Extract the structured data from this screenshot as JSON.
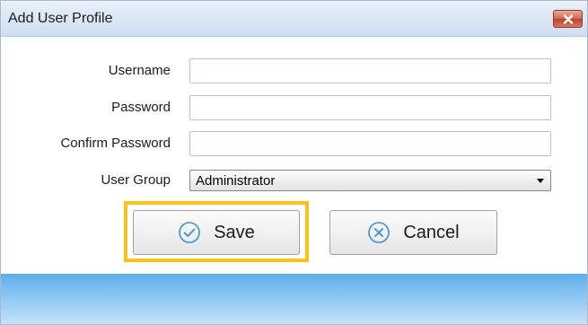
{
  "window": {
    "title": "Add User Profile"
  },
  "form": {
    "username": {
      "label": "Username",
      "value": ""
    },
    "password": {
      "label": "Password",
      "value": ""
    },
    "confirm_password": {
      "label": "Confirm Password",
      "value": ""
    },
    "user_group": {
      "label": "User Group",
      "selected": "Administrator"
    }
  },
  "buttons": {
    "save_label": "Save",
    "cancel_label": "Cancel"
  },
  "icons": {
    "close": "close-icon",
    "save": "check-circle-icon",
    "cancel": "x-circle-icon",
    "dropdown": "chevron-down-icon"
  },
  "colors": {
    "highlight": "#f6c21c",
    "close_button": "#c0412c",
    "icon_accent": "#3b8fd6",
    "footer": "#7fc0f0"
  }
}
